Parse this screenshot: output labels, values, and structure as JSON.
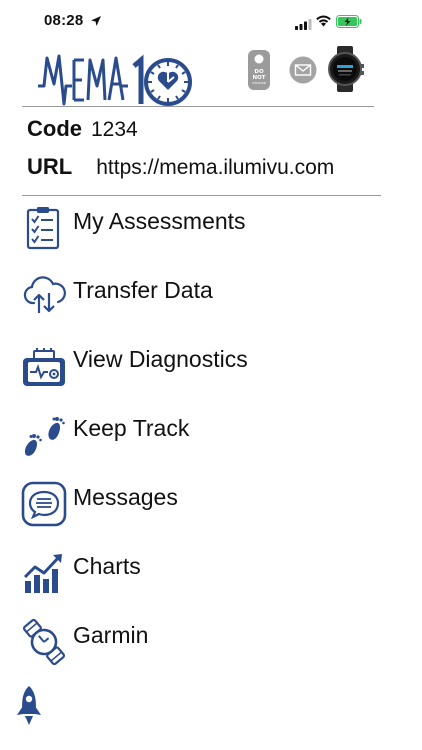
{
  "status_bar": {
    "time": "08:28"
  },
  "header": {
    "logo_text": "MEMA 10"
  },
  "info": {
    "code_label": "Code",
    "code_value": "1234",
    "url_label": "URL",
    "url_value": "https://mema.ilumivu.com"
  },
  "menu": {
    "items": [
      {
        "label": "My Assessments",
        "icon": "clipboard-checklist-icon"
      },
      {
        "label": "Transfer Data",
        "icon": "cloud-transfer-icon"
      },
      {
        "label": "View Diagnostics",
        "icon": "diagnostics-icon"
      },
      {
        "label": "Keep Track",
        "icon": "footsteps-icon"
      },
      {
        "label": "Messages",
        "icon": "message-bubble-icon"
      },
      {
        "label": "Charts",
        "icon": "chart-growth-icon"
      },
      {
        "label": "Garmin",
        "icon": "watch-icon"
      }
    ]
  },
  "colors": {
    "accent": "#2b4c8c",
    "divider": "#9a9a9a",
    "battery": "#35c759"
  }
}
